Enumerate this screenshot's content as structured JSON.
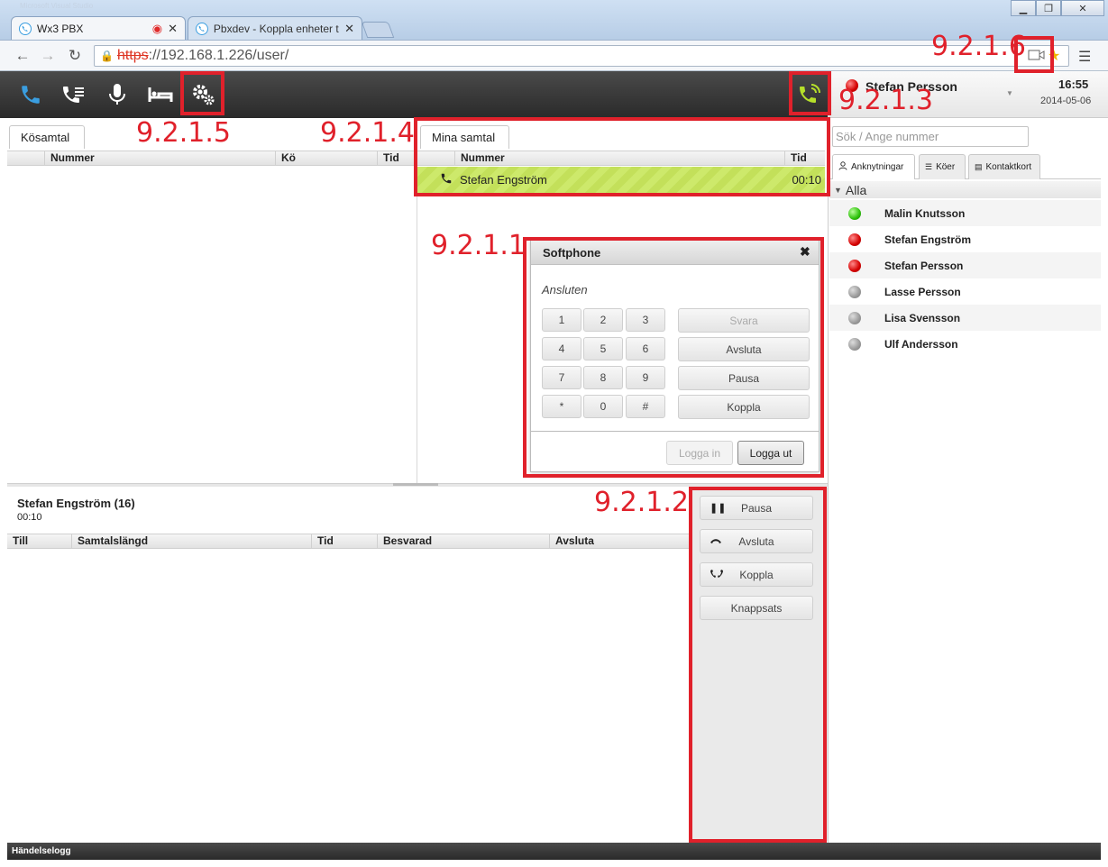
{
  "browser": {
    "tabs": [
      {
        "label": "Wx3 PBX"
      },
      {
        "label": "Pbxdev - Koppla enheter t"
      }
    ],
    "bg_title": "Microsoft Visual Studio",
    "url_scheme": "https",
    "url_rest": "://192.168.1.226/user/"
  },
  "toolbar": {
    "icons": [
      "phone-icon",
      "call-list-icon",
      "microphone-icon",
      "bed-icon",
      "settings-gears-icon"
    ],
    "softphone_icon": "softphone-ringing-icon"
  },
  "user": {
    "name": "Stefan Persson",
    "status_color": "#d40000",
    "time": "16:55",
    "date": "2014-05-06"
  },
  "queue_panel": {
    "tab_label": "Kösamtal",
    "columns": [
      "Nummer",
      "Kö",
      "Tid"
    ]
  },
  "my_calls": {
    "tab_label": "Mina samtal",
    "columns": [
      "Nummer",
      "Tid"
    ],
    "rows": [
      {
        "name": "Stefan Engström",
        "time": "00:10"
      }
    ]
  },
  "softphone": {
    "title": "Softphone",
    "status": "Ansluten",
    "keys": [
      "1",
      "2",
      "3",
      "4",
      "5",
      "6",
      "7",
      "8",
      "9",
      "*",
      "0",
      "#"
    ],
    "buttons": {
      "answer": "Svara",
      "hangup": "Avsluta",
      "pause": "Pausa",
      "transfer": "Koppla"
    },
    "login": "Logga in",
    "logout": "Logga ut"
  },
  "call_detail": {
    "title": "Stefan Engström (16)",
    "duration": "00:10",
    "columns": [
      "Till",
      "Samtalslängd",
      "Tid",
      "Besvarad",
      "Avsluta"
    ]
  },
  "actions": {
    "pause": "Pausa",
    "hangup": "Avsluta",
    "transfer": "Koppla",
    "keypad": "Knappsats"
  },
  "right_panel": {
    "search_placeholder": "Sök / Ange nummer",
    "tabs": [
      "Anknytningar",
      "Köer",
      "Kontaktkort"
    ],
    "group": "Alla",
    "contacts": [
      {
        "name": "Malin Knutsson",
        "status": "green"
      },
      {
        "name": "Stefan Engström",
        "status": "red"
      },
      {
        "name": "Stefan Persson",
        "status": "red"
      },
      {
        "name": "Lasse Persson",
        "status": "gray"
      },
      {
        "name": "Lisa Svensson",
        "status": "gray"
      },
      {
        "name": "Ulf Andersson",
        "status": "gray"
      }
    ]
  },
  "footer": {
    "label": "Händelselogg"
  },
  "annotations": [
    "9.2.1.1",
    "9.2.1.2",
    "9.2.1.3",
    "9.2.1.4",
    "9.2.1.5",
    "9.2.1.6"
  ],
  "colors": {
    "annotation": "#e0212b",
    "active_call": "#cde96b",
    "toolbar_icon_blue": "#3a9ee0",
    "softphone_icon": "#b6e02a"
  }
}
